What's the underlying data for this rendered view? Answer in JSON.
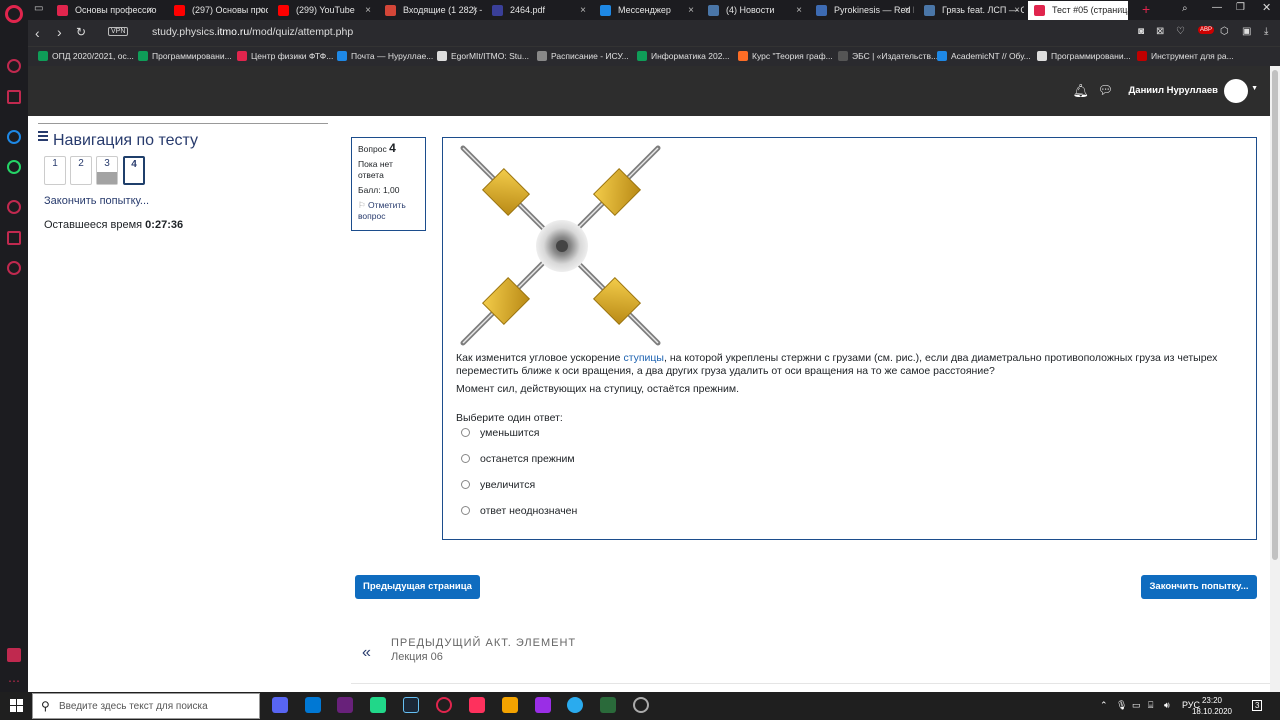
{
  "browser": {
    "tabs": [
      {
        "label": "Основы профессио",
        "color": "#e0254d",
        "active": false
      },
      {
        "label": "(297) Основы проф",
        "color": "#ff0000",
        "active": false
      },
      {
        "label": "(299) YouTube",
        "color": "#ff0000",
        "active": false
      },
      {
        "label": "Входящие (1 282) -",
        "color": "#d44638",
        "active": false
      },
      {
        "label": "2464.pdf",
        "color": "#3a3f99",
        "active": false
      },
      {
        "label": "Мессенджер",
        "color": "#1e88e5",
        "active": false
      },
      {
        "label": "(4) Новости",
        "color": "#4a76a8",
        "active": false
      },
      {
        "label": "Pyrokinesis — Red F",
        "color": "#3d6bb3",
        "active": false
      },
      {
        "label": "Грязь feat. ЛСП — С",
        "color": "#4a76a8",
        "active": false
      },
      {
        "label": "Тест #05 (страница",
        "color": "#e0254d",
        "active": true
      }
    ],
    "url_prefix": "study.physics.",
    "url_domain": "itmo.ru",
    "url_path": "/mod/quiz/attempt.php",
    "vpn_label": "VPN",
    "bookmarks": [
      {
        "label": "ОПД 2020/2021, ос...",
        "color": "#0f9d58"
      },
      {
        "label": "Программировани...",
        "color": "#0f9d58"
      },
      {
        "label": "Центр физики ФТФ...",
        "color": "#e0254d"
      },
      {
        "label": "Почта — Нуруллае...",
        "color": "#1e88e5"
      },
      {
        "label": "EgorMIt/ITMO: Stu...",
        "color": "#dddddd"
      },
      {
        "label": "Расписание - ИСУ...",
        "color": "#888888"
      },
      {
        "label": "Информатика 202...",
        "color": "#0f9d58"
      },
      {
        "label": "Курс \"Теория граф...",
        "color": "#fc6d26"
      },
      {
        "label": "ЭБС | «Издательств...",
        "color": "#555555"
      },
      {
        "label": "AcademicNT // Обу...",
        "color": "#1e88e5"
      },
      {
        "label": "Программировани...",
        "color": "#dddddd"
      },
      {
        "label": "Инструмент для ра...",
        "color": "#c00000"
      }
    ]
  },
  "header": {
    "username": "Даниил Нуруллаев"
  },
  "navigation": {
    "title": "Навигация по тесту",
    "questions": [
      "1",
      "2",
      "3",
      "4"
    ],
    "finish_link": "Закончить попытку...",
    "time_label": "Оставшееся время",
    "time_value": "0:27:36"
  },
  "question_info": {
    "label": "Вопрос",
    "number": "4",
    "status": "Пока нет ответа",
    "score": "Балл: 1,00",
    "flag": "Отметить вопрос"
  },
  "question": {
    "text_before": "Как изменится угловое ускорение ",
    "text_link": "ступицы",
    "text_after": ", на которой укреплены стержни с грузами (см. рис.), если два диаметрально противоположных груза из четырех переместить ближе к оси вращения, а два других груза удалить от оси вращения на то же самое расстояние?",
    "text2": "Момент сил, действующих на ступицу, остаётся прежним.",
    "prompt": "Выберите один ответ:",
    "options": [
      "уменьшится",
      "останется прежним",
      "увеличится",
      "ответ неоднозначен"
    ]
  },
  "buttons": {
    "prev_page": "Предыдущая страница",
    "finish": "Закончить попытку..."
  },
  "prev_activity": {
    "heading": "ПРЕДЫДУЩИЙ АКТ. ЭЛЕМЕНТ",
    "name": "Лекция 06"
  },
  "taskbar": {
    "search_placeholder": "Введите здесь текст для поиска",
    "lang": "РУС",
    "time": "23:20",
    "date": "18.10.2020",
    "notification_count": "3"
  }
}
